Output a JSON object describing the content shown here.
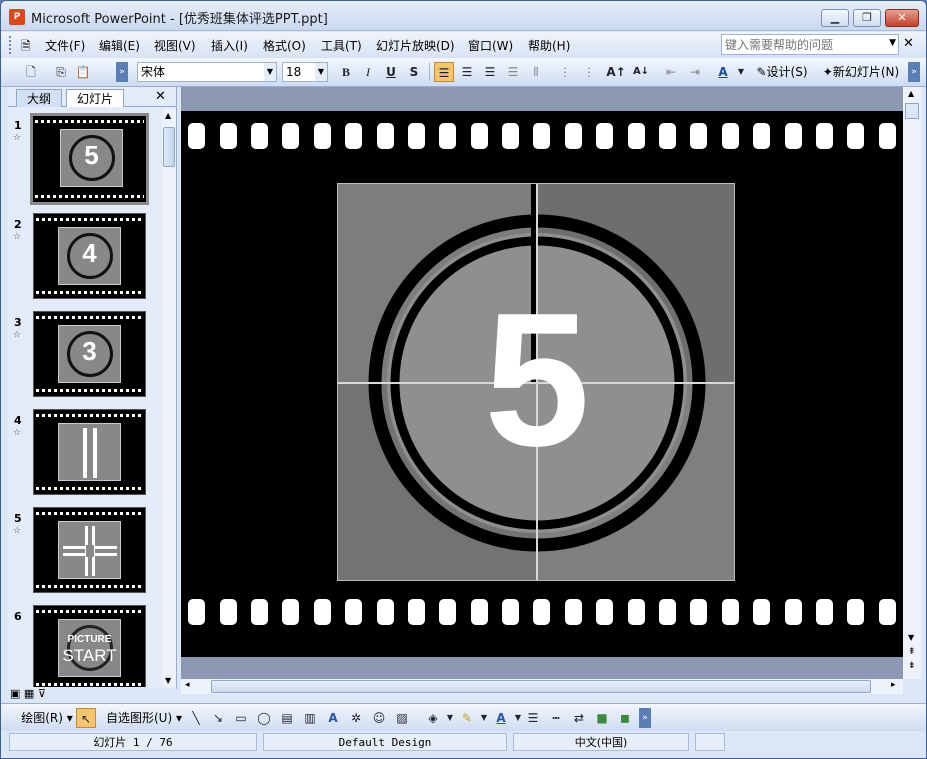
{
  "window": {
    "title": "Microsoft PowerPoint - [优秀班集体评选PPT.ppt]",
    "app_icon": "powerpoint-icon"
  },
  "menu": {
    "items": [
      "文件(F)",
      "编辑(E)",
      "视图(V)",
      "插入(I)",
      "格式(O)",
      "工具(T)",
      "幻灯片放映(D)",
      "窗口(W)",
      "帮助(H)"
    ]
  },
  "help": {
    "placeholder": "键入需要帮助的问题"
  },
  "toolbar": {
    "font": "宋体",
    "size": "18",
    "bold": "B",
    "italic": "I",
    "underline": "U",
    "shadow": "S",
    "design_label": "设计(S)",
    "new_slide_label": "新幻灯片(N)",
    "font_color_label": "A"
  },
  "panel": {
    "tab_outline": "大纲",
    "tab_slides": "幻灯片"
  },
  "slides": [
    {
      "num": "1",
      "content": "5"
    },
    {
      "num": "2",
      "content": "4"
    },
    {
      "num": "3",
      "content": "3"
    },
    {
      "num": "4",
      "content": ""
    },
    {
      "num": "5",
      "content": ""
    },
    {
      "num": "6",
      "content_line1": "PICTURE",
      "content_line2": "START"
    }
  ],
  "main_slide": {
    "number": "5"
  },
  "drawbar": {
    "draw_label": "绘图(R)",
    "autoshape_label": "自选图形(U)"
  },
  "status": {
    "slide_info": "幻灯片 1 / 76",
    "design": "Default Design",
    "language": "中文(中国)"
  }
}
